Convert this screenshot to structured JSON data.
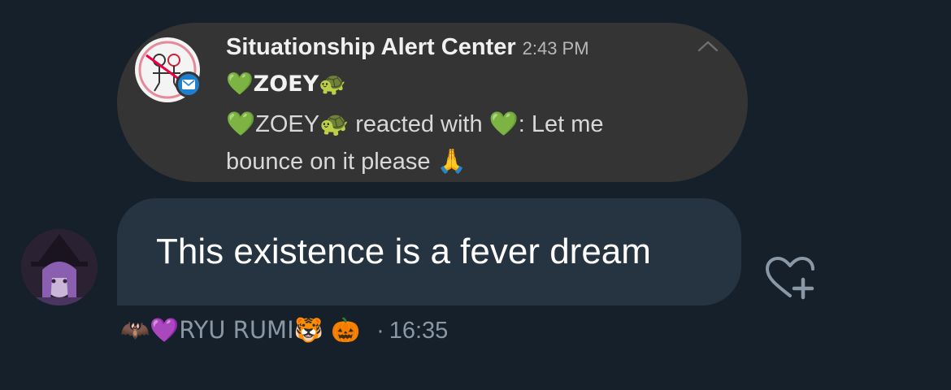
{
  "notification": {
    "title": "Situationship Alert Center",
    "time": "2:43 PM",
    "sender": "💚ZOEY🐢",
    "body": "💚ZOEY🐢 reacted with 💚: Let me bounce on it please 🙏",
    "icons": [
      "app-logo-icon",
      "mail-icon",
      "chevron-up-icon"
    ]
  },
  "message": {
    "text": "This existence is a fever dream",
    "sender": "🦇💜RYU RUMI🐯 🎃",
    "time": "16:35"
  },
  "colors": {
    "background": "#15202b",
    "bubble": "#263340",
    "notification_card": "#343434",
    "meta_text": "#8a98a5"
  }
}
